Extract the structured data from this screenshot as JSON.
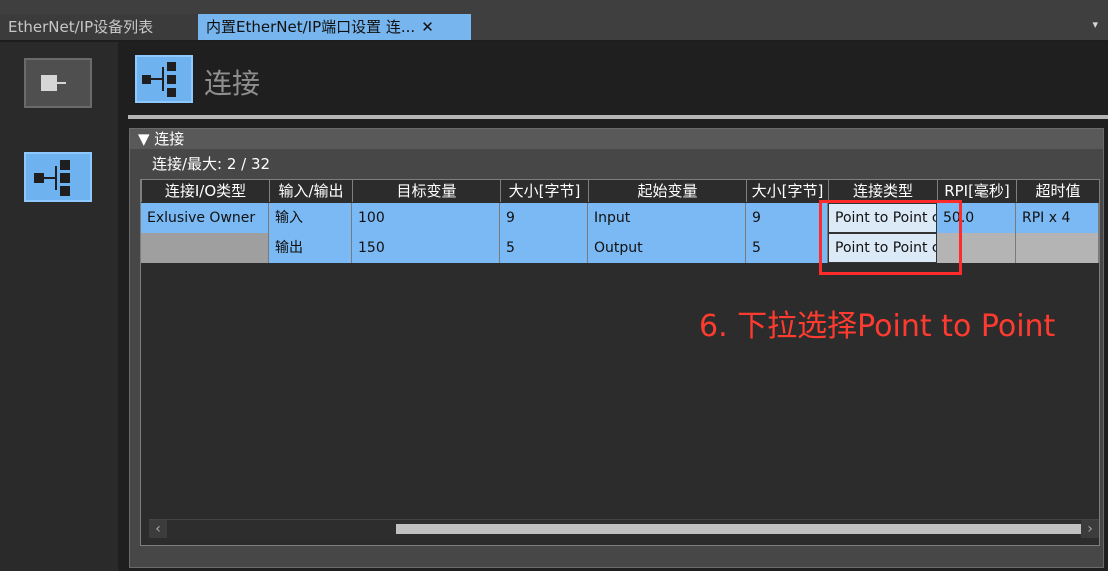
{
  "tabs": [
    {
      "label": "EtherNet/IP设备列表"
    },
    {
      "label": "内置EtherNet/IP端口设置 连...",
      "close": "✕"
    }
  ],
  "tab_dropdown": "▾",
  "header": {
    "title": "连接"
  },
  "panel": {
    "title": "▼ 连接",
    "count": "连接/最大: 2 / 32"
  },
  "columns": [
    "连接I/O类型",
    "输入/输出",
    "目标变量",
    "大小[字节]",
    "起始变量",
    "大小[字节]",
    "连接类型",
    "RPI[毫秒]",
    "超时值"
  ],
  "rows": [
    {
      "io_type": "Exlusive Owner",
      "direction": "输入",
      "target": "100",
      "size1": "9",
      "start": "Input",
      "size2": "9",
      "conn_type": "Point to Point c",
      "rpi": "50.0",
      "timeout": "RPI x 4"
    },
    {
      "io_type": "",
      "direction": "输出",
      "target": "150",
      "size1": "5",
      "start": "Output",
      "size2": "5",
      "conn_type": "Point to Point c",
      "rpi": "",
      "timeout": ""
    }
  ],
  "annotation": "6. 下拉选择Point to Point",
  "colors": {
    "accent": "#76b5ee",
    "annotation": "#ff3b30"
  }
}
